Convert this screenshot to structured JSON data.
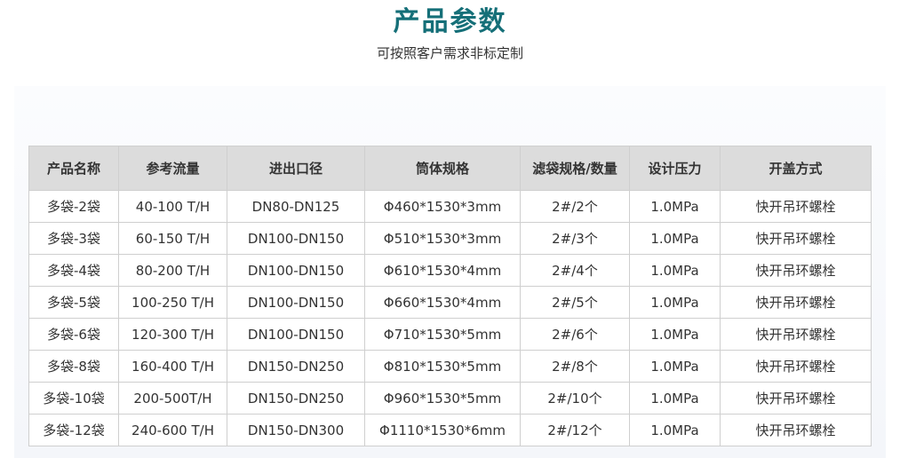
{
  "header": {
    "title": "产品参数",
    "subtitle": "可按照客户需求非标定制"
  },
  "table": {
    "columns": [
      "产品名称",
      "参考流量",
      "进出口径",
      "筒体规格",
      "滤袋规格/数量",
      "设计压力",
      "开盖方式"
    ],
    "rows": [
      [
        "多袋-2袋",
        "40-100 T/H",
        "DN80-DN125",
        "Φ460*1530*3mm",
        "2#/2个",
        "1.0MPa",
        "快开吊环螺栓"
      ],
      [
        "多袋-3袋",
        "60-150 T/H",
        "DN100-DN150",
        "Φ510*1530*3mm",
        "2#/3个",
        "1.0MPa",
        "快开吊环螺栓"
      ],
      [
        "多袋-4袋",
        "80-200 T/H",
        "DN100-DN150",
        "Φ610*1530*4mm",
        "2#/4个",
        "1.0MPa",
        "快开吊环螺栓"
      ],
      [
        "多袋-5袋",
        "100-250 T/H",
        "DN100-DN150",
        "Φ660*1530*4mm",
        "2#/5个",
        "1.0MPa",
        "快开吊环螺栓"
      ],
      [
        "多袋-6袋",
        "120-300 T/H",
        "DN100-DN150",
        "Φ710*1530*5mm",
        "2#/6个",
        "1.0MPa",
        "快开吊环螺栓"
      ],
      [
        "多袋-8袋",
        "160-400 T/H",
        "DN150-DN250",
        "Φ810*1530*5mm",
        "2#/8个",
        "1.0MPa",
        "快开吊环螺栓"
      ],
      [
        "多袋-10袋",
        "200-500T/H",
        "DN150-DN250",
        "Φ960*1530*5mm",
        "2#/10个",
        "1.0MPa",
        "快开吊环螺栓"
      ],
      [
        "多袋-12袋",
        "240-600 T/H",
        "DN150-DN300",
        "Φ1110*1530*6mm",
        "2#/12个",
        "1.0MPa",
        "快开吊环螺栓"
      ]
    ]
  },
  "colors": {
    "title": "#156f78",
    "header_bg": "#dcdcdc",
    "border": "#cfcfcf",
    "text": "#333333"
  }
}
